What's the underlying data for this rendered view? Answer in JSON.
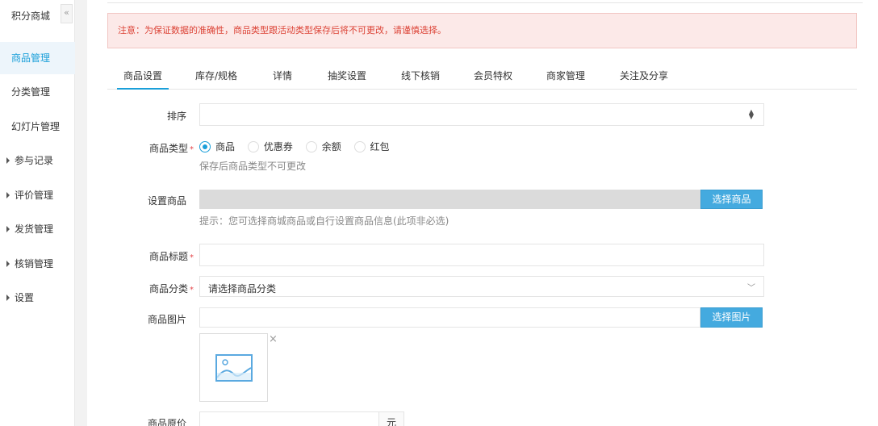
{
  "sidebar": {
    "title": "积分商城",
    "collapse_glyph": "«",
    "items": [
      {
        "label": "商品管理"
      },
      {
        "label": "分类管理"
      },
      {
        "label": "幻灯片管理"
      },
      {
        "label": "参与记录"
      },
      {
        "label": "评价管理"
      },
      {
        "label": "发货管理"
      },
      {
        "label": "核销管理"
      },
      {
        "label": "设置"
      }
    ]
  },
  "alert": {
    "text": "注意：为保证数据的准确性，商品类型跟活动类型保存后将不可更改，请谨慎选择。"
  },
  "tabs": [
    {
      "label": "商品设置"
    },
    {
      "label": "库存/规格"
    },
    {
      "label": "详情"
    },
    {
      "label": "抽奖设置"
    },
    {
      "label": "线下核销"
    },
    {
      "label": "会员特权"
    },
    {
      "label": "商家管理"
    },
    {
      "label": "关注及分享"
    }
  ],
  "form": {
    "sort_label": "排序",
    "sort_value": "",
    "type_label": "商品类型",
    "type_options": [
      {
        "label": "商品",
        "checked": true
      },
      {
        "label": "优惠券",
        "checked": false
      },
      {
        "label": "余额",
        "checked": false
      },
      {
        "label": "红包",
        "checked": false
      }
    ],
    "type_hint": "保存后商品类型不可更改",
    "set_goods_label": "设置商品",
    "select_goods_button": "选择商品",
    "set_goods_hint": "提示：您可选择商城商品或自行设置商品信息(此项非必选)",
    "title_label": "商品标题",
    "title_value": "",
    "category_label": "商品分类",
    "category_placeholder": "请选择商品分类",
    "image_label": "商品图片",
    "select_image_button": "选择图片",
    "price_label": "商品原价",
    "price_unit": "元",
    "required_mark": "*"
  },
  "colors": {
    "accent": "#1a9fd9",
    "button": "#44aadf",
    "alert_text": "#dc4437",
    "alert_bg": "#fce9e8"
  }
}
